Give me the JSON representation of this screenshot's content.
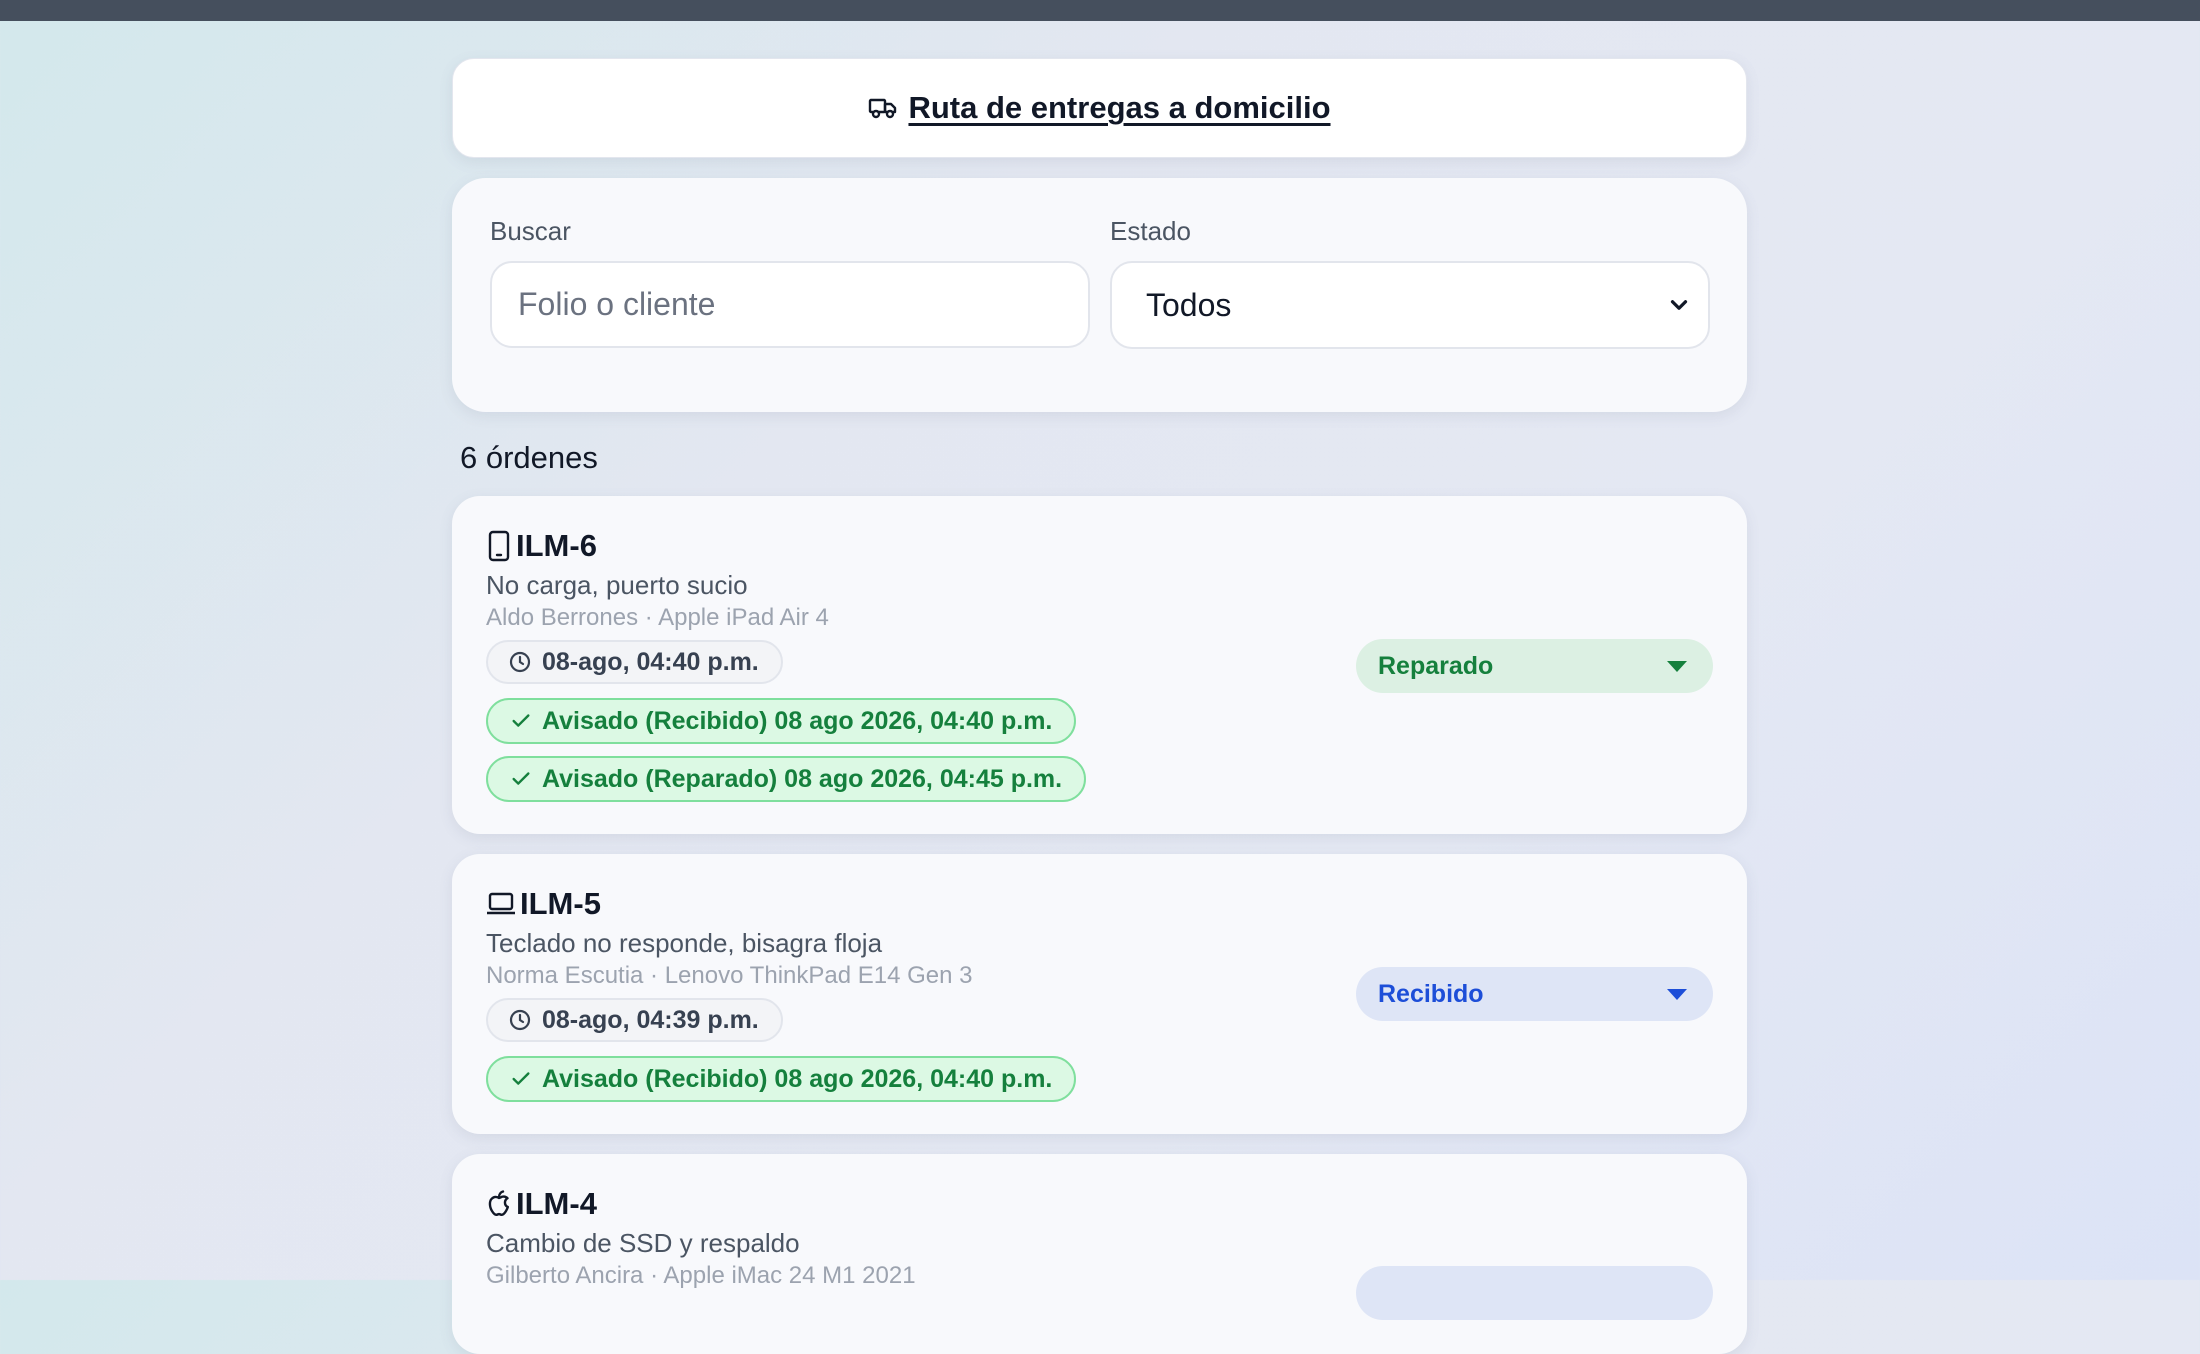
{
  "header": {
    "title": "Ruta de entregas a domicilio",
    "icon": "truck-icon"
  },
  "filters": {
    "search_label": "Buscar",
    "search_placeholder": "Folio o cliente",
    "search_value": "",
    "status_label": "Estado",
    "status_value": "Todos"
  },
  "count_text": "6 órdenes",
  "orders": [
    {
      "folio": "ILM-6",
      "icon": "tablet-icon",
      "description": "No carga, puerto sucio",
      "meta": "Aldo Berrones · Apple iPad Air 4",
      "time": "08-ago, 04:40 p.m.",
      "notices": [
        "Avisado (Recibido) 08 ago 2026, 04:40 p.m.",
        "Avisado (Reparado) 08 ago 2026, 04:45 p.m."
      ],
      "status": "Reparado",
      "status_color": "#15803d"
    },
    {
      "folio": "ILM-5",
      "icon": "laptop-icon",
      "description": "Teclado no responde, bisagra floja",
      "meta": "Norma Escutia · Lenovo ThinkPad E14 Gen 3",
      "time": "08-ago, 04:39 p.m.",
      "notices": [
        "Avisado (Recibido) 08 ago 2026, 04:40 p.m."
      ],
      "status": "Recibido",
      "status_color": "#1d4ed8"
    },
    {
      "folio": "ILM-4",
      "icon": "apple-icon",
      "description": "Cambio de SSD y respaldo",
      "meta": "Gilberto Ancira · Apple iMac 24 M1 2021"
    }
  ]
}
